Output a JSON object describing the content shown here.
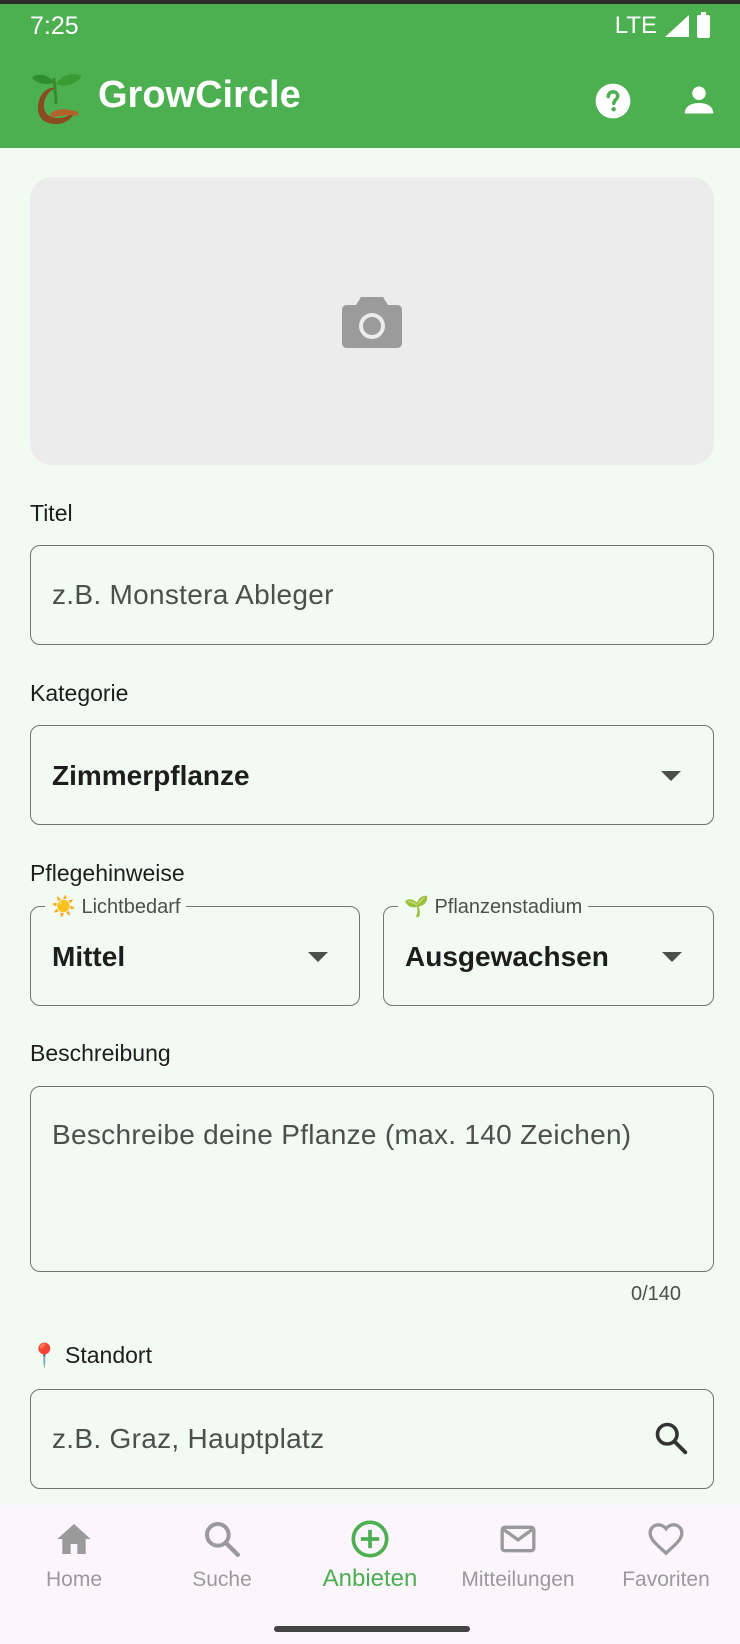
{
  "status_bar": {
    "time": "7:25",
    "network": "LTE"
  },
  "app_bar": {
    "title": "GrowCircle",
    "icons": [
      "help-icon",
      "account-icon"
    ]
  },
  "photo": {
    "icon": "camera-icon"
  },
  "form": {
    "title_label": "Titel",
    "title_placeholder": "z.B. Monstera Ableger",
    "category_label": "Kategorie",
    "category_value": "Zimmerpflanze",
    "care_label": "Pflegehinweise",
    "light_label": "☀️ Lichtbedarf",
    "light_value": "Mittel",
    "stage_label": "🌱 Pflanzenstadium",
    "stage_value": "Ausgewachsen",
    "description_label": "Beschreibung",
    "description_placeholder": "Beschreibe deine Pflanze (max. 140 Zeichen)",
    "description_counter": "0/140",
    "location_label": "📍 Standort",
    "location_placeholder": "z.B. Graz, Hauptplatz"
  },
  "bottom_nav": {
    "items": [
      {
        "label": "Home",
        "icon": "home-icon",
        "active": false
      },
      {
        "label": "Suche",
        "icon": "search-icon",
        "active": false
      },
      {
        "label": "Anbieten",
        "icon": "add-circle-icon",
        "active": true
      },
      {
        "label": "Mitteilungen",
        "icon": "mail-icon",
        "active": false
      },
      {
        "label": "Favoriten",
        "icon": "heart-icon",
        "active": false
      }
    ]
  },
  "colors": {
    "primary": "#4caf50",
    "background": "#f1fbf2",
    "nav_background": "#fcf5fc"
  }
}
